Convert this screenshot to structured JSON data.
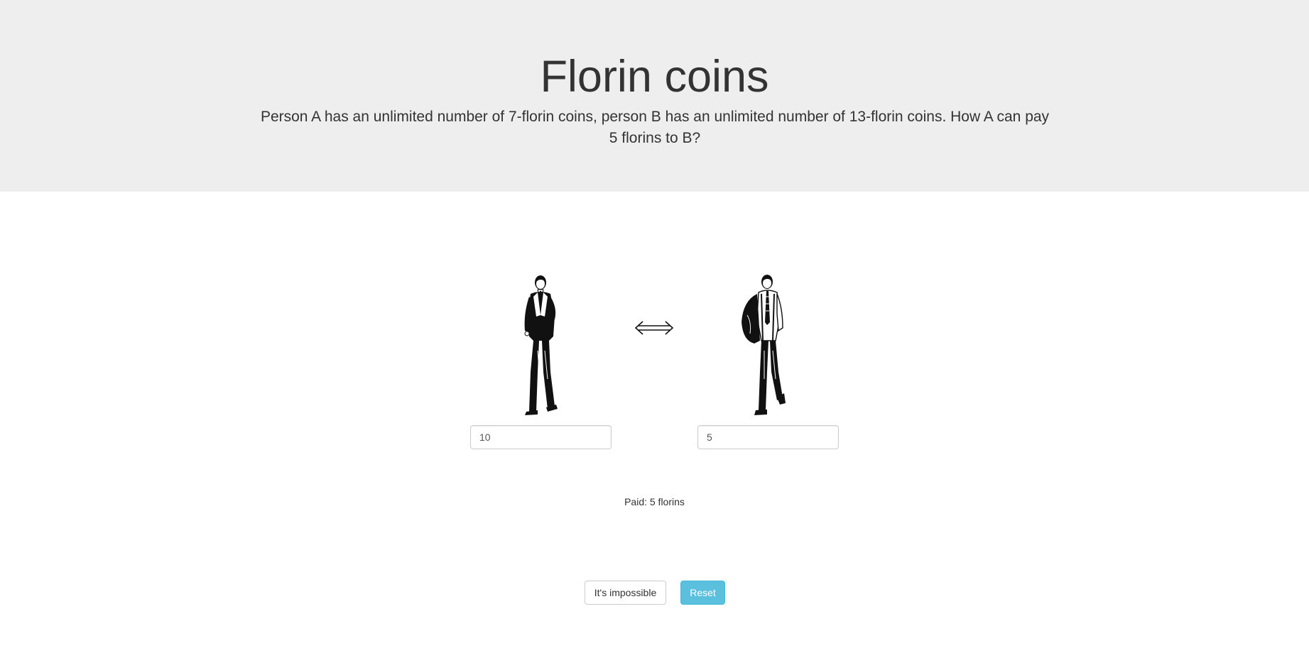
{
  "header": {
    "title": "Florin coins",
    "problem": "Person A has an unlimited number of 7-florin coins, person B has an unlimited number of 13-florin coins. How A can pay 5 florins to B?"
  },
  "persons": {
    "a": {
      "icon": "man-in-suit-illustration",
      "coins_value": "10"
    },
    "b": {
      "icon": "man-with-jacket-over-shoulder-illustration",
      "coins_value": "5"
    }
  },
  "exchange_icon": "double-arrow-icon",
  "status": {
    "paid_text": "Paid: 5 florins"
  },
  "buttons": {
    "impossible_label": "It's impossible",
    "reset_label": "Reset"
  },
  "colors": {
    "header_bg": "#eeeeee",
    "reset_bg": "#5bc0de"
  }
}
